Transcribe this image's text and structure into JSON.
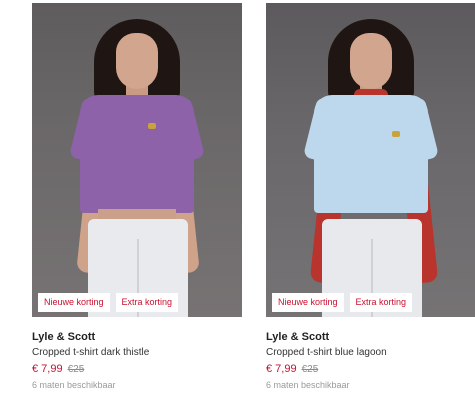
{
  "products": [
    {
      "badges": [
        "Nieuwe korting",
        "Extra korting"
      ],
      "brand": "Lyle & Scott",
      "title": "Cropped t-shirt dark thistle",
      "price_now": "€ 7,99",
      "price_old": "€25",
      "sizes": "6 maten beschikbaar",
      "color": "#8d62a8"
    },
    {
      "badges": [
        "Nieuwe korting",
        "Extra korting"
      ],
      "brand": "Lyle & Scott",
      "title": "Cropped t-shirt blue lagoon",
      "price_now": "€ 7,99",
      "price_old": "€25",
      "sizes": "6 maten beschikbaar",
      "color": "#bdd8ec"
    }
  ],
  "colors": {
    "accent": "#c8102e",
    "muted": "#9a9a9a"
  }
}
